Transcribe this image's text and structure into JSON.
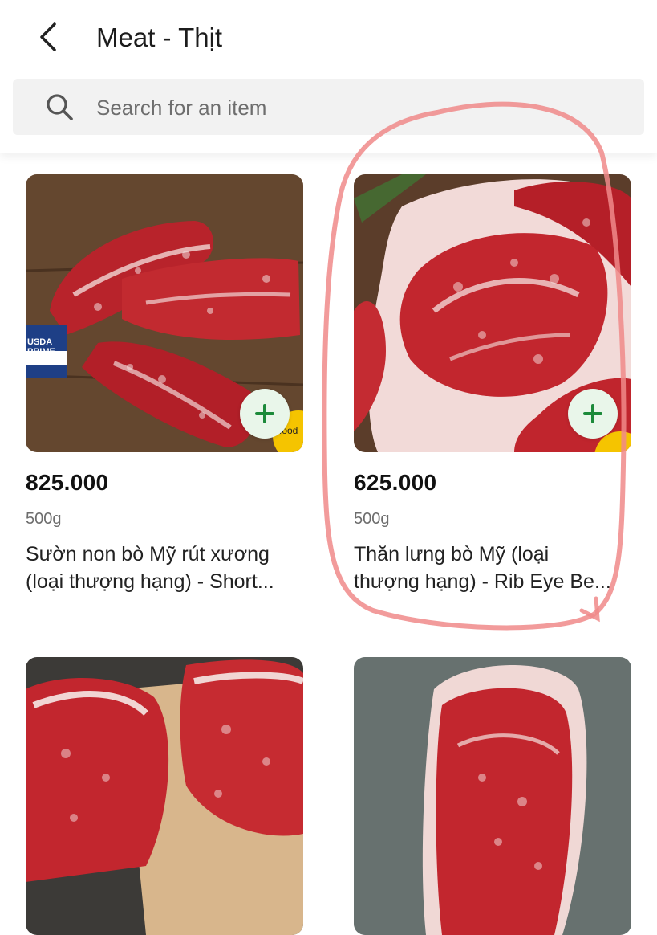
{
  "header": {
    "title": "Meat - Thịt",
    "back_icon": "chevron-left-icon"
  },
  "search": {
    "placeholder": "Search for an item",
    "icon": "search-icon"
  },
  "products": [
    {
      "price": "825.000",
      "weight": "500g",
      "name_line1": "Sườn non bò Mỹ rút xương",
      "name_line2": "(loại thượng hạng) - Short...",
      "label_on_image": "USDA PRIME",
      "badge_text": "food"
    },
    {
      "price": "625.000",
      "weight": "500g",
      "name_line1": "Thăn lưng bò Mỹ (loại",
      "name_line2": "thượng hạng) - Rib Eye Be..."
    },
    {},
    {}
  ],
  "colors": {
    "add_button_bg": "#e9f6ea",
    "add_button_icon": "#1c8a3a",
    "annotation": "#f08a8a"
  }
}
